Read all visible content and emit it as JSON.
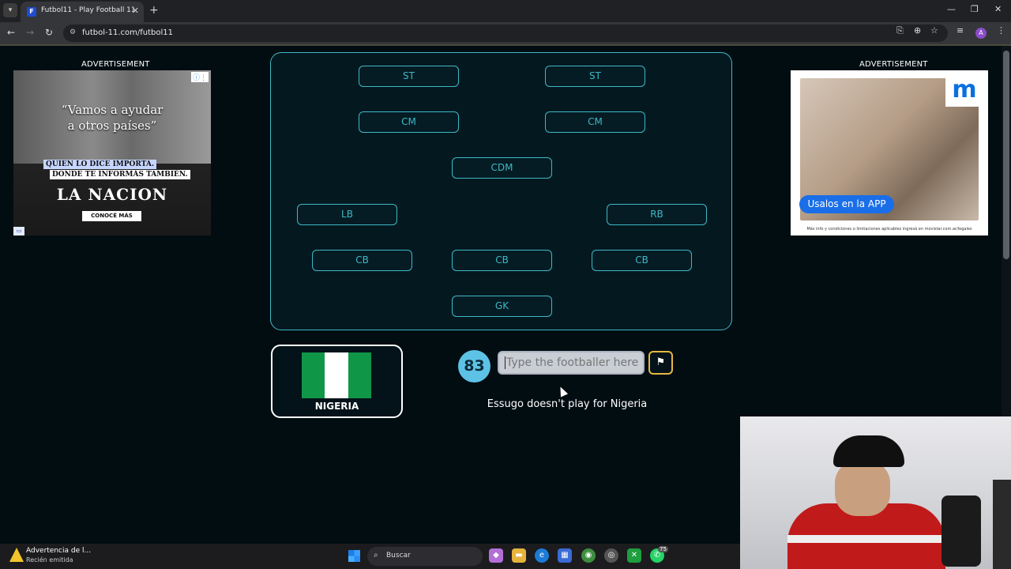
{
  "browser": {
    "tab_title": "Futbol11 - Play Football 11",
    "tab_favicon": "F",
    "url": "futbol-11.com/futbol11",
    "profile_initial": "A"
  },
  "ads": {
    "label": "ADVERTISEMENT",
    "left": {
      "quote": "“Vamos a ayudar a otros países”",
      "line1": "QUIEN LO DICE IMPORTA.",
      "line2": "DONDE TE INFORMÁS TAMBIÉN.",
      "brand": "LA NACION",
      "cta": "CONOCÉ MÁS"
    },
    "right": {
      "logo": "m",
      "button": "Usalos en la APP",
      "fine_print": "Más info y condiciones o limitaciones aplicables ingresá en movistar.com.ar/legales"
    }
  },
  "formation": {
    "positions": [
      "ST",
      "ST",
      "CM",
      "CM",
      "CDM",
      "LB",
      "RB",
      "CB",
      "CB",
      "CB",
      "GK"
    ]
  },
  "country": {
    "name": "NIGERIA",
    "flag_colors": [
      "#0f9647",
      "#ffffff",
      "#0f9647"
    ]
  },
  "game": {
    "remaining": "83",
    "input_placeholder": "Type the footballer here",
    "message": "Essugo doesn't play for Nigeria"
  },
  "taskbar": {
    "notif_title": "Advertencia de l...",
    "notif_subtitle": "Recién emitida",
    "search_label": "Buscar",
    "badge": "75"
  },
  "colors": {
    "accent": "#3fb8c4",
    "background": "#020d12",
    "counter": "#5dc3e6",
    "give_up_border": "#e6b840"
  }
}
